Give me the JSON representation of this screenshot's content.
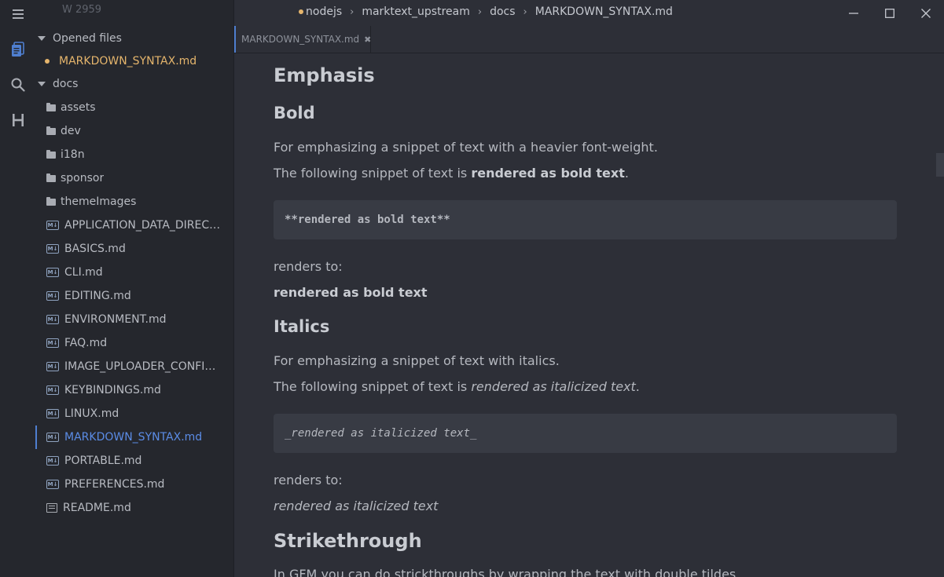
{
  "app": {
    "word_count": "W 2959"
  },
  "sidebar": {
    "opened_files_label": "Opened files",
    "opened_files": [
      {
        "label": "MARKDOWN_SYNTAX.md"
      }
    ],
    "folder_label": "docs",
    "items": [
      {
        "type": "folder",
        "label": "assets"
      },
      {
        "type": "folder",
        "label": "dev"
      },
      {
        "type": "folder",
        "label": "i18n"
      },
      {
        "type": "folder",
        "label": "sponsor"
      },
      {
        "type": "folder",
        "label": "themeImages"
      },
      {
        "type": "md",
        "label": "APPLICATION_DATA_DIRECTORY.md"
      },
      {
        "type": "md",
        "label": "BASICS.md"
      },
      {
        "type": "md",
        "label": "CLI.md"
      },
      {
        "type": "md",
        "label": "EDITING.md"
      },
      {
        "type": "md",
        "label": "ENVIRONMENT.md"
      },
      {
        "type": "md",
        "label": "FAQ.md"
      },
      {
        "type": "md",
        "label": "IMAGE_UPLOADER_CONFIGRATION.md"
      },
      {
        "type": "md",
        "label": "KEYBINDINGS.md"
      },
      {
        "type": "md",
        "label": "LINUX.md"
      },
      {
        "type": "md",
        "label": "MARKDOWN_SYNTAX.md",
        "active": true
      },
      {
        "type": "md",
        "label": "PORTABLE.md"
      },
      {
        "type": "md",
        "label": "PREFERENCES.md"
      },
      {
        "type": "readme",
        "label": "README.md"
      }
    ]
  },
  "titlebar": {
    "breadcrumbs": [
      "nodejs",
      "marktext_upstream",
      "docs",
      "MARKDOWN_SYNTAX.md"
    ]
  },
  "tabs": [
    {
      "label": "MARKDOWN_SYNTAX.md",
      "close": "✖"
    }
  ],
  "document": {
    "h_emphasis": "Emphasis",
    "h_bold": "Bold",
    "bold_p1": "For emphasizing a snippet of text with a heavier font-weight.",
    "bold_p2_pre": "The following snippet of text is ",
    "bold_p2_strong": "rendered as bold text",
    "bold_p2_post": ".",
    "bold_code": "**rendered as bold text**",
    "renders_to_1": "renders to:",
    "bold_result": "rendered as bold text",
    "h_italics": "Italics",
    "ital_p1": "For emphasizing a snippet of text with italics.",
    "ital_p2_pre": "The following snippet of text is ",
    "ital_p2_em": "rendered as italicized text",
    "ital_p2_post": ".",
    "ital_code": "_rendered as italicized text_",
    "renders_to_2": "renders to:",
    "ital_result": "rendered as italicized text",
    "h_strike": "Strikethrough",
    "strike_p1": "In GFM you can do strickthroughs by wrapping the text with double tildes."
  },
  "icons": {
    "menu": "hamburger-menu-icon",
    "files": "files-icon",
    "search": "search-icon",
    "toc": "heading-icon"
  },
  "colors": {
    "accent": "#4f7fd0",
    "unsaved_dot": "#e5b56c",
    "active_file": "#5b8ce6"
  }
}
